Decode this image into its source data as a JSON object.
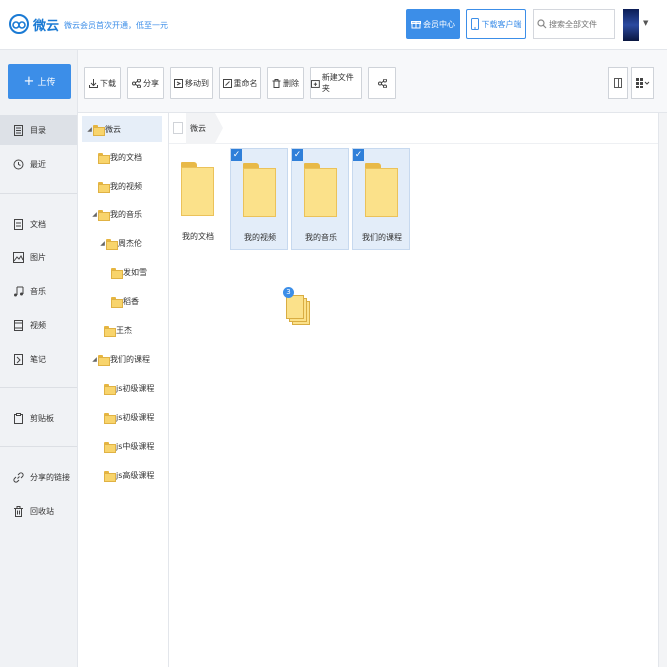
{
  "header": {
    "logo_text": "微云",
    "promo_text": "微云会员首次开通，低至一元",
    "vip_label": "会员中心",
    "client_label": "下载客户端",
    "search_placeholder": "搜索全部文件"
  },
  "sidebar": {
    "upload_label": "上传",
    "items": [
      {
        "label": "目录",
        "icon": "directory-icon"
      },
      {
        "label": "最近",
        "icon": "clock-icon"
      },
      {
        "label": "文档",
        "icon": "document-icon"
      },
      {
        "label": "图片",
        "icon": "image-icon"
      },
      {
        "label": "音乐",
        "icon": "music-icon"
      },
      {
        "label": "视频",
        "icon": "video-icon"
      },
      {
        "label": "笔记",
        "icon": "note-icon"
      },
      {
        "label": "剪贴板",
        "icon": "clipboard-icon"
      },
      {
        "label": "分享的链接",
        "icon": "link-icon"
      },
      {
        "label": "回收站",
        "icon": "trash-icon"
      }
    ]
  },
  "toolbar": {
    "download": "下载",
    "share": "分享",
    "move": "移动到",
    "rename": "重命名",
    "delete": "删除",
    "new_folder": "新建文件夹"
  },
  "tree": {
    "items": [
      {
        "label": "微云"
      },
      {
        "label": "我的文档"
      },
      {
        "label": "我的视频"
      },
      {
        "label": "我的音乐"
      },
      {
        "label": "周杰伦"
      },
      {
        "label": "发如雪"
      },
      {
        "label": "稻香"
      },
      {
        "label": "王杰"
      },
      {
        "label": "我们的课程"
      },
      {
        "label": "js初级课程"
      },
      {
        "label": "js初级课程"
      },
      {
        "label": "js中级课程"
      },
      {
        "label": "js高级课程"
      }
    ]
  },
  "breadcrumb": {
    "current": "微云"
  },
  "files": [
    {
      "name": "我的文档",
      "checked": false
    },
    {
      "name": "我的视频",
      "checked": true
    },
    {
      "name": "我的音乐",
      "checked": true
    },
    {
      "name": "我们的课程",
      "checked": true
    }
  ],
  "drag": {
    "count": "3"
  },
  "colors": {
    "accent": "#3c8ee8",
    "folder": "#fbe18a"
  }
}
